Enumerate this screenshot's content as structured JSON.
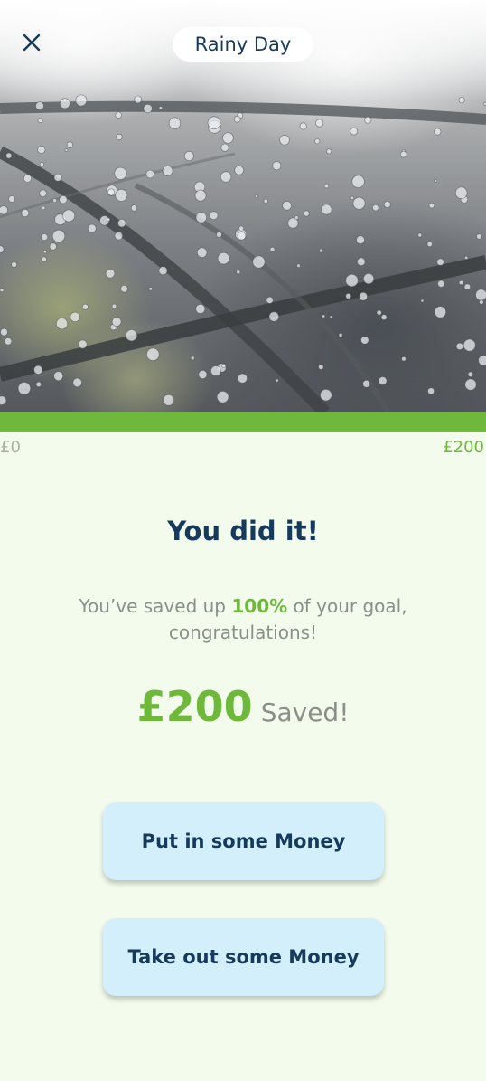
{
  "header": {
    "title": "Rainy Day",
    "close_icon": "close-icon"
  },
  "hero": {
    "image_subject": "raindrops-on-clear-umbrella"
  },
  "progress": {
    "fraction": 1.0,
    "min_label": "£0",
    "max_label": "£200",
    "fill_color": "#6eb83c"
  },
  "celebration": {
    "headline": "You did it!",
    "message_prefix": "You’ve saved up ",
    "message_percent": "100%",
    "message_suffix": " of your goal, congratulations!",
    "saved_amount": "£200",
    "saved_label": "Saved!"
  },
  "actions": {
    "put_in_label": "Put in some Money",
    "take_out_label": "Take out some Money"
  },
  "colors": {
    "accent_green": "#6eb83c",
    "navy_text": "#163a5c",
    "button_bg": "#d3effb",
    "page_bg": "#f3fcec"
  }
}
